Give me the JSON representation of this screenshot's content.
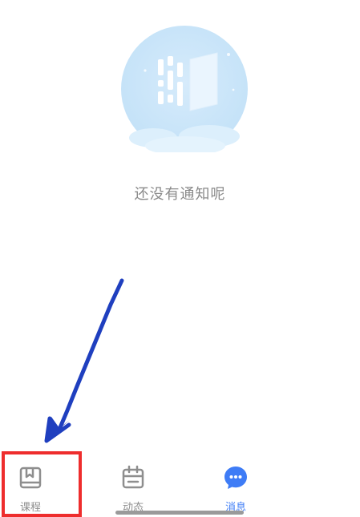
{
  "empty_state": {
    "message": "还没有通知呢",
    "illustration_icon": "empty-notification-illustration"
  },
  "tabbar": {
    "tabs": [
      {
        "label": "课程",
        "icon": "book-icon",
        "active": false
      },
      {
        "label": "动态",
        "icon": "calendar-icon",
        "active": false
      },
      {
        "label": "消息",
        "icon": "chat-bubble-icon",
        "active": true
      }
    ]
  },
  "annotation": {
    "arrow_color": "#1f3fbf",
    "highlight_color": "#ee2d2d"
  },
  "colors": {
    "accent": "#3e7cf6",
    "inactive": "#8e8e8e"
  }
}
